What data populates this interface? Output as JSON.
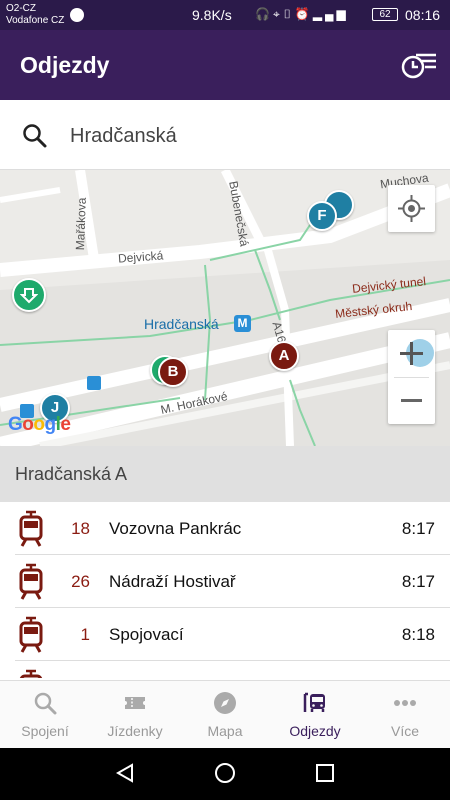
{
  "status_bar": {
    "carrier_line1": "O2-CZ",
    "carrier_line2": "Vodafone CZ",
    "net_speed": "9.8K/s",
    "battery": "62",
    "time": "08:16"
  },
  "header": {
    "title": "Odjezdy"
  },
  "search": {
    "value": "Hradčanská"
  },
  "map": {
    "street_labels": [
      "Mařákova",
      "Bubenečská",
      "Dejvická",
      "Muchova",
      "M. Horákové"
    ],
    "station_label": "Hradčanská",
    "metro_badge": "M",
    "tunnel_labels": [
      "Dejvický tunel",
      "Městský okruh"
    ],
    "road_label": "A16",
    "stops": [
      "A",
      "B",
      "F",
      "J"
    ],
    "attribution": "Google",
    "colors": {
      "stop_maroon": "#7a1a10",
      "stop_teal": "#1f7fa3",
      "stop_green": "#1eaa6c"
    }
  },
  "stop_header": "Hradčanská A",
  "departures": [
    {
      "line": "18",
      "destination": "Vozovna Pankrác",
      "time": "8:17"
    },
    {
      "line": "26",
      "destination": "Nádraží Hostivař",
      "time": "8:17"
    },
    {
      "line": "1",
      "destination": "Spojovací",
      "time": "8:18"
    }
  ],
  "bottom_nav": {
    "items": [
      {
        "label": "Spojení",
        "icon": "search-icon"
      },
      {
        "label": "Jízdenky",
        "icon": "ticket-icon"
      },
      {
        "label": "Mapa",
        "icon": "compass-icon"
      },
      {
        "label": "Odjezdy",
        "icon": "bus-icon"
      },
      {
        "label": "Více",
        "icon": "more-icon"
      }
    ],
    "active": "Odjezdy"
  },
  "theme": {
    "primary": "#3a1f5c",
    "status_bar": "#2b1a4a",
    "accent_line": "#8b1c12"
  }
}
